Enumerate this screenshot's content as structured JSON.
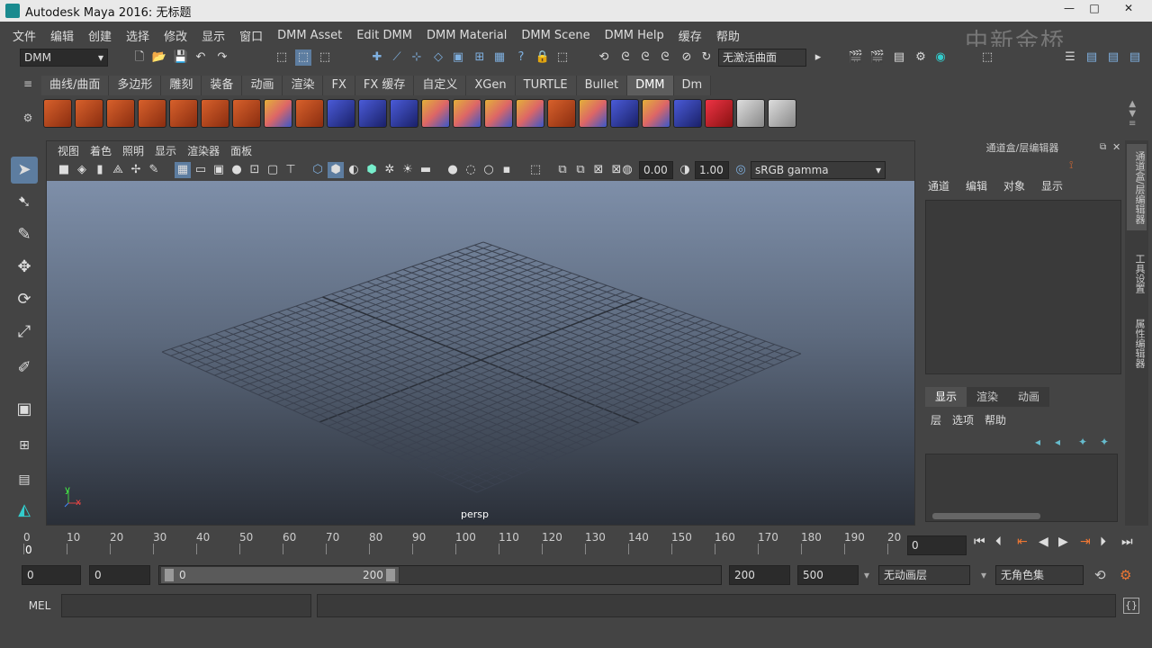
{
  "title": "Autodesk Maya 2016: 无标题",
  "window_controls": {
    "min": "—",
    "max": "□",
    "close": "✕"
  },
  "menubar": [
    "文件",
    "编辑",
    "创建",
    "选择",
    "修改",
    "显示",
    "窗口",
    "DMM Asset",
    "Edit DMM",
    "DMM Material",
    "DMM Scene",
    "DMM Help",
    "缓存",
    "帮助"
  ],
  "watermark": "中新金桥",
  "menuset": "DMM",
  "live_surface": "无激活曲面",
  "shelf_tabs": [
    "曲线/曲面",
    "多边形",
    "雕刻",
    "装备",
    "动画",
    "渲染",
    "FX",
    "FX 缓存",
    "自定义",
    "XGen",
    "TURTLE",
    "Bullet",
    "DMM",
    "Dm"
  ],
  "shelf_active": "DMM",
  "viewport": {
    "menu": [
      "视图",
      "着色",
      "照明",
      "显示",
      "渲染器",
      "面板"
    ],
    "exposure": "0.00",
    "gamma": "1.00",
    "colorspace": "sRGB gamma",
    "camera": "persp",
    "axis_y": "y",
    "axis_x": "x"
  },
  "right_panel": {
    "header": "通道盒/层编辑器",
    "menu": [
      "通道",
      "编辑",
      "对象",
      "显示"
    ],
    "layer_tabs": [
      "显示",
      "渲染",
      "动画"
    ],
    "layer_menu": [
      "层",
      "选项",
      "帮助"
    ]
  },
  "side_tabs": [
    "通道盒/层编辑器",
    "工具设置",
    "属性编辑器"
  ],
  "timeline": {
    "ticks": [
      "0",
      "10",
      "20",
      "30",
      "40",
      "50",
      "60",
      "70",
      "80",
      "90",
      "100",
      "110",
      "120",
      "130",
      "140",
      "150",
      "160",
      "170",
      "180",
      "190",
      "20"
    ],
    "current_frame": "0",
    "playhead": "0"
  },
  "range": {
    "start": "0",
    "playback_start": "0",
    "slider_start": "0",
    "slider_end": "200",
    "playback_end": "200",
    "end": "500",
    "anim_layer": "无动画层",
    "char_set": "无角色集"
  },
  "mel": {
    "label": "MEL"
  },
  "colors": {
    "accent": "#5d7da0",
    "viewport_top": "#7e8fa9",
    "viewport_bottom": "#2a2f38"
  }
}
